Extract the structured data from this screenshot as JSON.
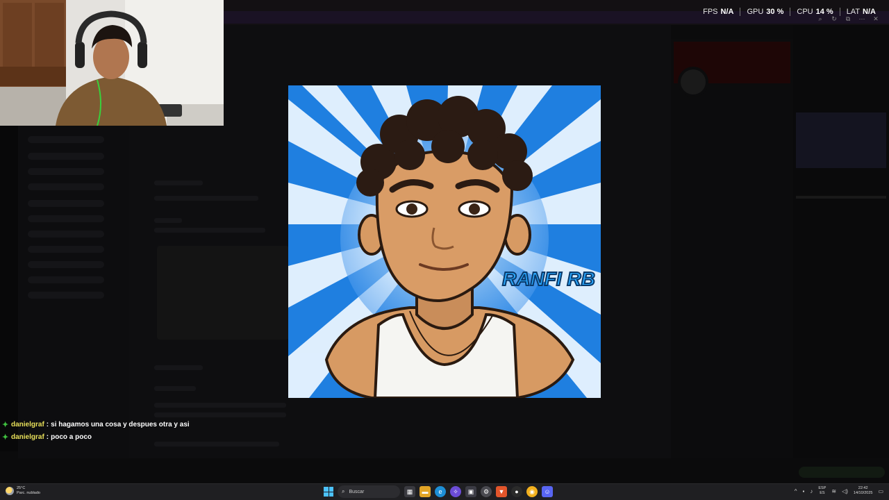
{
  "perf_overlay": {
    "fps_label": "FPS",
    "fps_value": "N/A",
    "gpu_label": "GPU",
    "gpu_value": "30 %",
    "cpu_label": "CPU",
    "cpu_value": "14 %",
    "lat_label": "LAT",
    "lat_value": "N/A"
  },
  "image_viewer": {
    "avatar_caption": "RANFI RB",
    "accent_color": "#1f7fe0"
  },
  "chat_overlay": {
    "messages": [
      {
        "user": "danielgraf",
        "text": "si hagamos una cosa y despues otra y asi"
      },
      {
        "user": "danielgraf",
        "text": "poco a poco"
      }
    ],
    "badge_color": "#3fbf3f",
    "user_color": "#e8e05a"
  },
  "taskbar": {
    "weather_temp": "25°C",
    "weather_desc": "Parc. nublado",
    "search_placeholder": "Buscar",
    "language": "ESP",
    "language_sub": "ES",
    "time": "22:42",
    "date": "14/10/2025",
    "icons": [
      "widgets-icon",
      "file-explorer-icon",
      "edge-icon",
      "copilot-icon",
      "store-icon",
      "settings-icon",
      "brave-icon",
      "github-icon",
      "chrome-icon",
      "discord-icon"
    ]
  }
}
